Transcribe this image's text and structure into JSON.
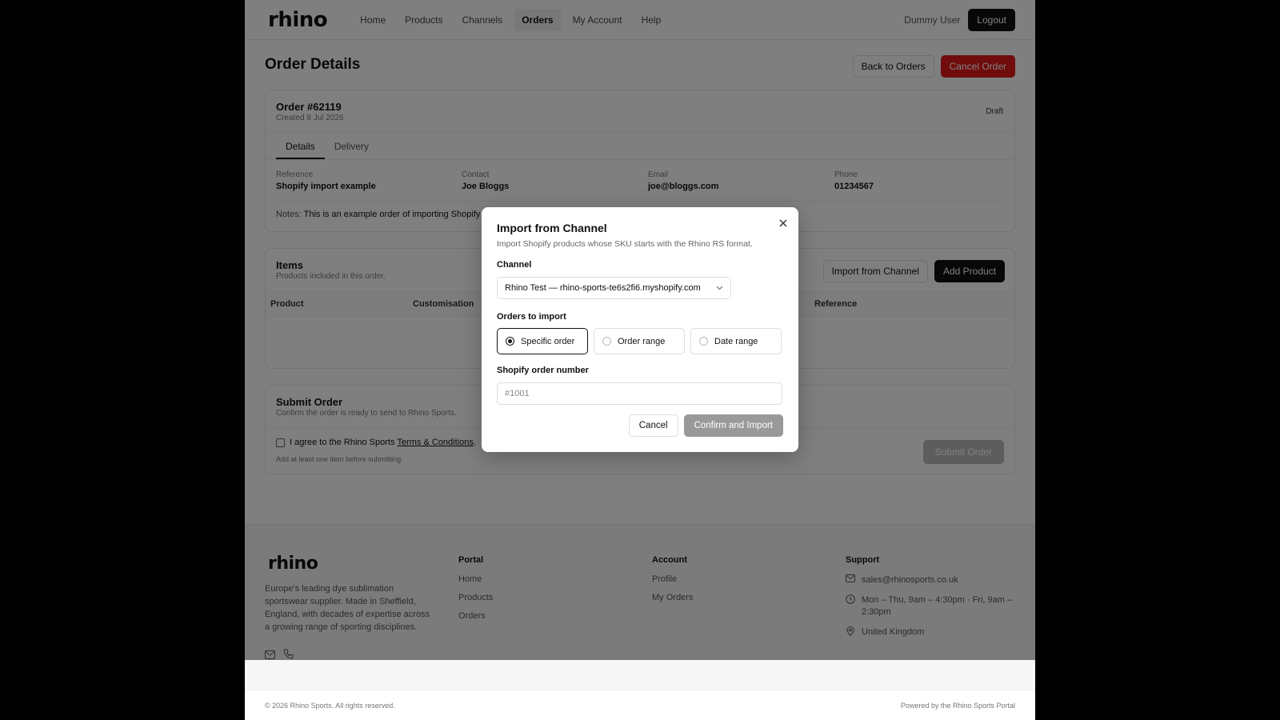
{
  "header": {
    "logo": "rhino",
    "nav": [
      {
        "label": "Home"
      },
      {
        "label": "Products"
      },
      {
        "label": "Channels"
      },
      {
        "label": "Orders"
      },
      {
        "label": "My Account"
      },
      {
        "label": "Help"
      }
    ],
    "active_nav": "Orders",
    "user_name": "Dummy User",
    "logout_label": "Logout"
  },
  "page": {
    "title": "Order Details",
    "back_label": "Back to Orders",
    "cancel_order_label": "Cancel Order"
  },
  "order": {
    "number": "Order #62119",
    "created": "Created 8 Jul 2026",
    "status": "Draft",
    "tabs": [
      {
        "label": "Details"
      },
      {
        "label": "Delivery"
      }
    ],
    "active_tab": "Details",
    "details": [
      {
        "label": "Reference",
        "value": "Shopify import example"
      },
      {
        "label": "Contact",
        "value": "Joe Bloggs"
      },
      {
        "label": "Email",
        "value": "joe@bloggs.com"
      },
      {
        "label": "Phone",
        "value": "01234567"
      }
    ],
    "notes_label": "Notes:",
    "notes_text": "This is an example order of importing Shopify"
  },
  "items": {
    "title": "Items",
    "subtitle": "Products included in this order.",
    "import_label": "Import from Channel",
    "add_label": "Add Product",
    "columns": [
      {
        "label": "Product"
      },
      {
        "label": "Customisation"
      },
      {
        "label": "Reference"
      }
    ]
  },
  "submit": {
    "title": "Submit Order",
    "subtitle": "Confirm the order is ready to send to Rhino Sports.",
    "agree_prefix": "I agree to the Rhino Sports",
    "terms_label": "Terms & Conditions",
    "agree_suffix": ".",
    "hint": "Add at least one item before submitting.",
    "button_label": "Submit Order"
  },
  "modal": {
    "title": "Import from Channel",
    "subtitle": "Import Shopify products whose SKU starts with the Rhino RS format.",
    "channel_label": "Channel",
    "channel_value": "Rhino Test — rhino-sports-te6s2fi6.myshopify.com",
    "orders_label": "Orders to import",
    "options": [
      {
        "label": "Specific order"
      },
      {
        "label": "Order range"
      },
      {
        "label": "Date range"
      }
    ],
    "selected_option": "Specific order",
    "order_number_label": "Shopify order number",
    "order_number_placeholder": "#1001",
    "order_number_value": "",
    "cancel_label": "Cancel",
    "confirm_label": "Confirm and Import"
  },
  "footer": {
    "logo": "rhino",
    "about": "Europe's leading dye sublimation sportswear supplier. Made in Sheffield, England, with decades of expertise across a growing range of sporting disciplines.",
    "portal_title": "Portal",
    "portal_links": [
      {
        "label": "Home"
      },
      {
        "label": "Products"
      },
      {
        "label": "Orders"
      }
    ],
    "account_title": "Account",
    "account_links": [
      {
        "label": "Profile"
      },
      {
        "label": "My Orders"
      }
    ],
    "support_title": "Support",
    "support_email": "sales@rhinosports.co.uk",
    "support_hours": "Mon – Thu, 9am – 4:30pm · Fri, 9am – 2:30pm",
    "support_location": "United Kingdom",
    "copyright": "© 2026 Rhino Sports. All rights reserved.",
    "powered": "Powered by the Rhino Sports Portal"
  },
  "colors": {
    "accent_red": "#e11919",
    "primary_dark": "#111111",
    "overlay": "rgba(0,0,0,0.5)"
  },
  "icons": {
    "close": "close-icon",
    "chevron": "chevron-down-icon",
    "mail": "mail-icon",
    "phone": "phone-icon",
    "clock": "clock-icon",
    "location": "location-pin-icon"
  }
}
